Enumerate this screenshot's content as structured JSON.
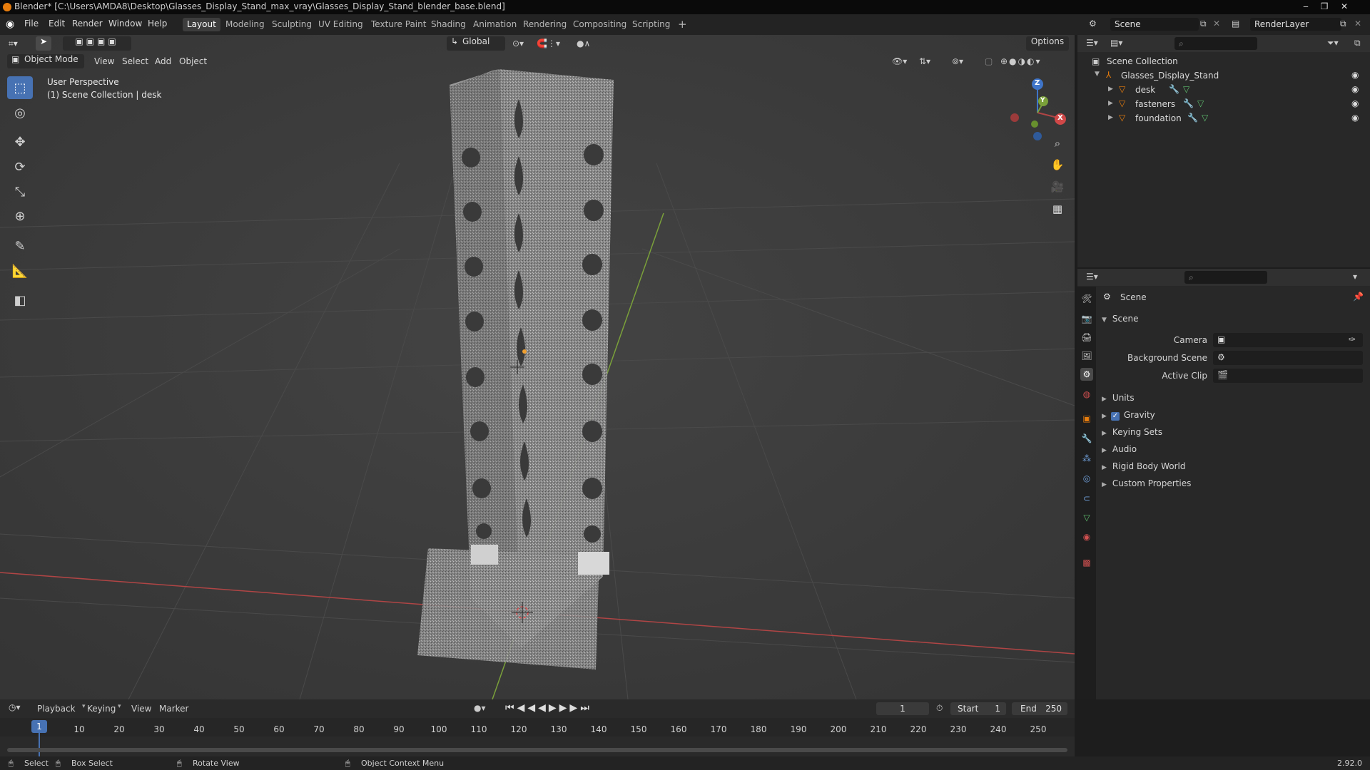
{
  "title_bar": {
    "title": "Blender* [C:\\Users\\AMDA8\\Desktop\\Glasses_Display_Stand_max_vray\\Glasses_Display_Stand_blender_base.blend]"
  },
  "menu": [
    "File",
    "Edit",
    "Render",
    "Window",
    "Help"
  ],
  "workspaces": [
    "Layout",
    "Modeling",
    "Sculpting",
    "UV Editing",
    "Texture Paint",
    "Shading",
    "Animation",
    "Rendering",
    "Compositing",
    "Scripting"
  ],
  "workspace_add": "+",
  "scene_field": "Scene",
  "view_layer_field": "RenderLayer",
  "viewport": {
    "mode": "Object Mode",
    "header_menu": [
      "View",
      "Select",
      "Add",
      "Object"
    ],
    "transform_orientation": "Global",
    "options": "Options",
    "overlay_title": "User Perspective",
    "overlay_subtitle": "(1) Scene Collection | desk",
    "gizmo_axes": {
      "z": "Z",
      "y": "Y",
      "x": "X"
    },
    "colors": {
      "x_axis": "#b04545",
      "y_axis": "#7aa03a",
      "z_axis": "#3f75c9"
    }
  },
  "outliner": {
    "root": "Scene Collection",
    "collection": "Glasses_Display_Stand",
    "objects": [
      "desk",
      "fasteners",
      "foundation"
    ]
  },
  "properties": {
    "header": "Scene",
    "panel": "Scene",
    "camera_label": "Camera",
    "background_scene_label": "Background Scene",
    "active_clip_label": "Active Clip",
    "sections": [
      "Units",
      "Gravity",
      "Keying Sets",
      "Audio",
      "Rigid Body World",
      "Custom Properties"
    ],
    "gravity_checked": true
  },
  "timeline": {
    "menus": [
      "Playback",
      "Keying",
      "View",
      "Marker"
    ],
    "current_frame": "1",
    "start_label": "Start",
    "start_value": "1",
    "end_label": "End",
    "end_value": "250",
    "ticks": [
      "1",
      "10",
      "20",
      "30",
      "40",
      "50",
      "60",
      "70",
      "80",
      "90",
      "100",
      "110",
      "120",
      "130",
      "140",
      "150",
      "160",
      "170",
      "180",
      "190",
      "200",
      "210",
      "220",
      "230",
      "240",
      "250"
    ],
    "playhead_frame": "1"
  },
  "statusbar": {
    "select": "Select",
    "box_select": "Box Select",
    "rotate_view": "Rotate View",
    "context_menu": "Object Context Menu",
    "version": "2.92.0"
  },
  "colors": {
    "accent": "#4772b3",
    "brand": "#e87d0d"
  }
}
